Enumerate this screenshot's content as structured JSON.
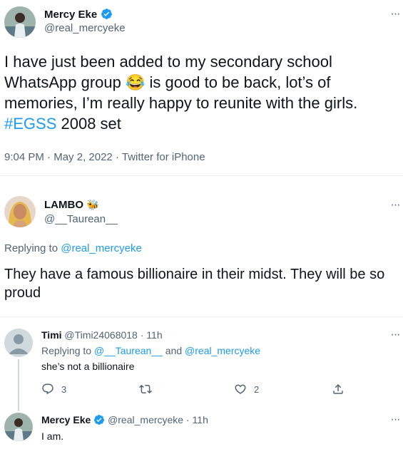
{
  "main_tweet": {
    "display_name": "Mercy Eke",
    "handle": "@real_mercyeke",
    "text_before": "I have just been added to my secondary school WhatsApp group",
    "emoji": "😂",
    "text_after": "is good to be back, lot’s of memories, I’m really happy to reunite with the girls.",
    "hashtag": "#EGSS",
    "text_end": "2008 set",
    "time": "9:04 PM",
    "date": "May 2, 2022",
    "source": "Twitter for iPhone"
  },
  "reply1": {
    "display_name": "LAMBO",
    "name_emoji": "🐝",
    "handle": "@__Taurean__",
    "replying_label": "Replying to",
    "replying_to": "@real_mercyeke",
    "text": "They have a famous billionaire in their midst. They will be so proud"
  },
  "reply2": {
    "display_name": "Timi",
    "handle": "@Timi24068018",
    "time": "11h",
    "replying_label": "Replying to",
    "replying_to_1": "@__Taurean__",
    "and_label": "and",
    "replying_to_2": "@real_mercyeke",
    "text": "she’s not a billionaire",
    "reply_count": "3",
    "like_count": "2"
  },
  "reply3": {
    "display_name": "Mercy Eke",
    "handle": "@real_mercyeke",
    "time": "11h",
    "text": "I am."
  },
  "separator": "·",
  "colors": {
    "accent": "#1d9bf0",
    "muted": "#536471",
    "divider": "#eff3f4"
  }
}
